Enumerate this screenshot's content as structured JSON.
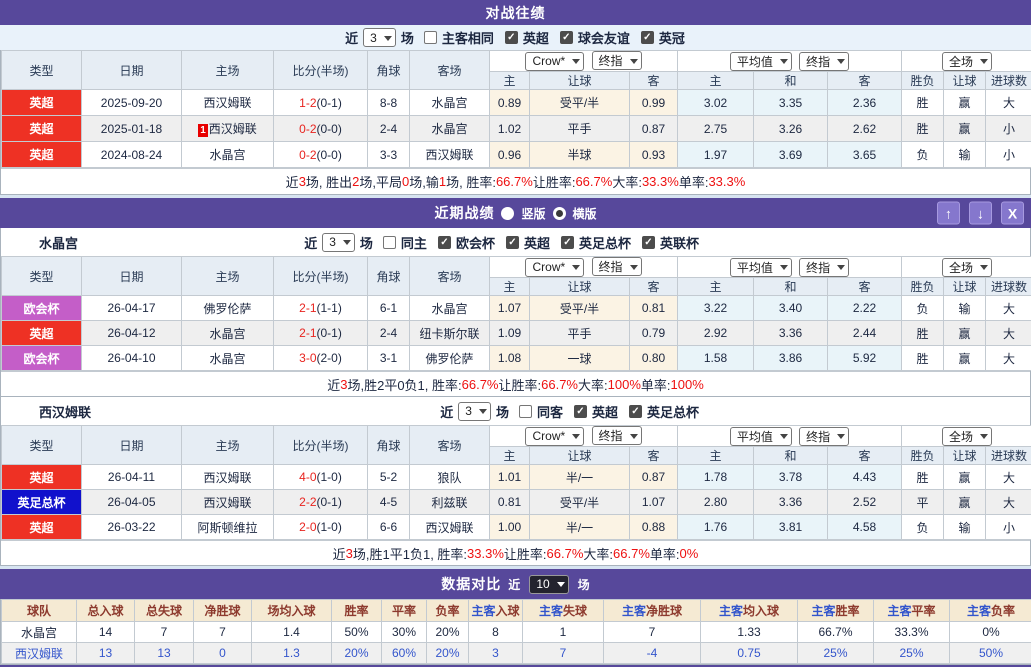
{
  "colors": {
    "purple": "#57489b",
    "type_red": "#ee3124",
    "type_orchid": "#c45ec8",
    "type_blue": "#1111cc",
    "team_green": "#0a9a3c",
    "win_red": "#e8241f",
    "lose_blue": "#1414cc",
    "draw_green": "#0a9a3c",
    "summary_red": "#ee1111",
    "compare_blue": "#3355cc",
    "compare_maroon": "#8d3a2e"
  },
  "icons": {
    "up": "↑",
    "down": "↓",
    "close": "X"
  },
  "dd": {
    "crow": "Crow*",
    "final": "终指",
    "avg": "平均值",
    "full": "全场"
  },
  "cols": {
    "type": "类型",
    "date": "日期",
    "home": "主场",
    "score": "比分(半场)",
    "corner": "角球",
    "away": "客场",
    "h": "主",
    "handicap": "让球",
    "a": "客",
    "avg_h": "主",
    "avg_d": "和",
    "avg_a": "客",
    "wl": "胜负",
    "hd": "让球",
    "goals": "进球数"
  },
  "h2h": {
    "title": "对战往绩",
    "filter": {
      "near": "近",
      "n": "3",
      "games": "场",
      "same": "主客相同",
      "leagues": [
        "英超",
        "球会友谊",
        "英冠"
      ]
    },
    "rows": [
      {
        "type": "英超",
        "badge": "",
        "date": "2025-09-20",
        "home": "西汉姆联",
        "home_c": "",
        "score": "1-2",
        "half": "(0-1)",
        "corner": "8-8",
        "away": "水晶宫",
        "away_c": "green",
        "o_h": "0.89",
        "o_hc": "受平/半",
        "o_a": "0.99",
        "m_h": "3.02",
        "m_d": "3.35",
        "m_a": "2.36",
        "wl": "胜",
        "wl_c": "red",
        "hd": "赢",
        "hd_c": "red",
        "gl": "大",
        "gl_c": "red"
      },
      {
        "type": "英超",
        "badge": "1",
        "date": "2025-01-18",
        "home": "西汉姆联",
        "home_c": "",
        "score": "0-2",
        "half": "(0-0)",
        "corner": "2-4",
        "away": "水晶宫",
        "away_c": "green",
        "o_h": "1.02",
        "o_hc": "平手",
        "o_a": "0.87",
        "m_h": "2.75",
        "m_d": "3.26",
        "m_a": "2.62",
        "wl": "胜",
        "wl_c": "red",
        "hd": "赢",
        "hd_c": "red",
        "gl": "小",
        "gl_c": "blue"
      },
      {
        "type": "英超",
        "badge": "",
        "date": "2024-08-24",
        "home": "水晶宫",
        "home_c": "green",
        "score": "0-2",
        "half": "(0-0)",
        "corner": "3-3",
        "away": "西汉姆联",
        "away_c": "",
        "o_h": "0.96",
        "o_hc": "半球",
        "o_a": "0.93",
        "m_h": "1.97",
        "m_d": "3.69",
        "m_a": "3.65",
        "wl": "负",
        "wl_c": "blue",
        "hd": "输",
        "hd_c": "blue",
        "gl": "小",
        "gl_c": "blue"
      }
    ],
    "summary": [
      {
        "t": "近 "
      },
      {
        "t": "3",
        "c": "red"
      },
      {
        "t": " 场, 胜出 "
      },
      {
        "t": "2",
        "c": "red"
      },
      {
        "t": " 场,平局 "
      },
      {
        "t": "0",
        "c": "red"
      },
      {
        "t": " 场,输 "
      },
      {
        "t": "1",
        "c": "red"
      },
      {
        "t": " 场, 胜率: "
      },
      {
        "t": "66.7%",
        "c": "red"
      },
      {
        "t": " 让胜率: "
      },
      {
        "t": "66.7%",
        "c": "red"
      },
      {
        "t": " 大率: "
      },
      {
        "t": "33.3%",
        "c": "red"
      },
      {
        "t": " 单率: "
      },
      {
        "t": "33.3%",
        "c": "red"
      }
    ]
  },
  "recent": {
    "title": "近期战绩",
    "radios": [
      "竖版",
      "横版"
    ],
    "teams": [
      {
        "name": "水晶宫",
        "filter": {
          "near": "近",
          "n": "3",
          "games": "场",
          "same": "同主",
          "leagues": [
            "欧会杯",
            "英超",
            "英足总杯",
            "英联杯"
          ]
        },
        "rows": [
          {
            "type": "欧会杯",
            "date": "26-04-17",
            "home": "佛罗伦萨",
            "home_c": "",
            "score": "2-1",
            "half": "(1-1)",
            "corner": "6-1",
            "away": "水晶宫",
            "away_c": "green",
            "o_h": "1.07",
            "o_hc": "受平/半",
            "o_a": "0.81",
            "m_h": "3.22",
            "m_d": "3.40",
            "m_a": "2.22",
            "wl": "负",
            "wl_c": "blue",
            "hd": "输",
            "hd_c": "blue",
            "gl": "大",
            "gl_c": "red"
          },
          {
            "type": "英超",
            "date": "26-04-12",
            "home": "水晶宫",
            "home_c": "green",
            "score": "2-1",
            "half": "(0-1)",
            "corner": "2-4",
            "away": "纽卡斯尔联",
            "away_c": "",
            "o_h": "1.09",
            "o_hc": "平手",
            "o_a": "0.79",
            "m_h": "2.92",
            "m_d": "3.36",
            "m_a": "2.44",
            "wl": "胜",
            "wl_c": "red",
            "hd": "赢",
            "hd_c": "red",
            "gl": "大",
            "gl_c": "red"
          },
          {
            "type": "欧会杯",
            "date": "26-04-10",
            "home": "水晶宫",
            "home_c": "green",
            "score": "3-0",
            "half": "(2-0)",
            "corner": "3-1",
            "away": "佛罗伦萨",
            "away_c": "",
            "o_h": "1.08",
            "o_hc": "一球",
            "o_a": "0.80",
            "m_h": "1.58",
            "m_d": "3.86",
            "m_a": "5.92",
            "wl": "胜",
            "wl_c": "red",
            "hd": "赢",
            "hd_c": "red",
            "gl": "大",
            "gl_c": "red"
          }
        ],
        "summary": [
          {
            "t": "近"
          },
          {
            "t": "3",
            "c": "red"
          },
          {
            "t": "场,胜2平0负1, 胜率:"
          },
          {
            "t": "66.7%",
            "c": "red"
          },
          {
            "t": " 让胜率:"
          },
          {
            "t": "66.7%",
            "c": "red"
          },
          {
            "t": " 大率:"
          },
          {
            "t": "100%",
            "c": "red"
          },
          {
            "t": " 单率:"
          },
          {
            "t": "100%",
            "c": "red"
          }
        ]
      },
      {
        "name": "西汉姆联",
        "filter": {
          "near": "近",
          "n": "3",
          "games": "场",
          "same": "同客",
          "leagues": [
            "英超",
            "英足总杯"
          ]
        },
        "rows": [
          {
            "type": "英超",
            "date": "26-04-11",
            "home": "西汉姆联",
            "home_c": "green",
            "score": "4-0",
            "half": "(1-0)",
            "corner": "5-2",
            "away": "狼队",
            "away_c": "",
            "o_h": "1.01",
            "o_hc": "半/一",
            "o_a": "0.87",
            "m_h": "1.78",
            "m_d": "3.78",
            "m_a": "4.43",
            "wl": "胜",
            "wl_c": "red",
            "hd": "赢",
            "hd_c": "red",
            "gl": "大",
            "gl_c": "red"
          },
          {
            "type": "英足总杯",
            "date": "26-04-05",
            "home": "西汉姆联",
            "home_c": "green",
            "score": "2-2",
            "half": "(0-1)",
            "corner": "4-5",
            "away": "利兹联",
            "away_c": "",
            "o_h": "0.81",
            "o_hc": "受平/半",
            "o_a": "1.07",
            "m_h": "2.80",
            "m_d": "3.36",
            "m_a": "2.52",
            "wl": "平",
            "wl_c": "green",
            "hd": "赢",
            "hd_c": "red",
            "gl": "大",
            "gl_c": "red"
          },
          {
            "type": "英超",
            "date": "26-03-22",
            "home": "阿斯顿维拉",
            "home_c": "",
            "score": "2-0",
            "half": "(1-0)",
            "corner": "6-6",
            "away": "西汉姆联",
            "away_c": "green",
            "o_h": "1.00",
            "o_hc": "半/一",
            "o_a": "0.88",
            "m_h": "1.76",
            "m_d": "3.81",
            "m_a": "4.58",
            "wl": "负",
            "wl_c": "blue",
            "hd": "输",
            "hd_c": "blue",
            "gl": "小",
            "gl_c": "blue"
          }
        ],
        "summary": [
          {
            "t": "近"
          },
          {
            "t": "3",
            "c": "red"
          },
          {
            "t": "场,胜1平1负1, 胜率:"
          },
          {
            "t": "33.3%",
            "c": "red"
          },
          {
            "t": " 让胜率:"
          },
          {
            "t": "66.7%",
            "c": "red"
          },
          {
            "t": " 大率:"
          },
          {
            "t": "66.7%",
            "c": "red"
          },
          {
            "t": " 单率:"
          },
          {
            "t": "0%",
            "c": "red"
          }
        ]
      }
    ]
  },
  "compare": {
    "title": "数据对比",
    "near": "近",
    "n": "10",
    "games": "场",
    "headers": [
      [
        {
          "t": "球队"
        }
      ],
      [
        {
          "t": "总入球"
        }
      ],
      [
        {
          "t": "总失球"
        }
      ],
      [
        {
          "t": "净胜球"
        }
      ],
      [
        {
          "t": "场均入球"
        }
      ],
      [
        {
          "t": "胜率"
        }
      ],
      [
        {
          "t": "平率"
        }
      ],
      [
        {
          "t": "负率"
        }
      ],
      [
        {
          "t": "主客",
          "c": "blue"
        },
        {
          "t": "入球"
        }
      ],
      [
        {
          "t": "主客",
          "c": "blue"
        },
        {
          "t": "失球"
        }
      ],
      [
        {
          "t": "主客",
          "c": "blue"
        },
        {
          "t": "净胜球"
        }
      ],
      [
        {
          "t": "主客",
          "c": "blue"
        },
        {
          "t": "均入球"
        }
      ],
      [
        {
          "t": "主客",
          "c": "blue"
        },
        {
          "t": "胜率"
        }
      ],
      [
        {
          "t": "主客",
          "c": "blue"
        },
        {
          "t": "平率"
        }
      ],
      [
        {
          "t": "主客",
          "c": "blue"
        },
        {
          "t": "负率"
        }
      ]
    ],
    "rows": [
      {
        "team": "水晶宫",
        "values": [
          "14",
          "7",
          "7",
          "1.4",
          "50%",
          "30%",
          "20%",
          "8",
          "1",
          "7",
          "1.33",
          "66.7%",
          "33.3%",
          "0%"
        ]
      },
      {
        "team": "西汉姆联",
        "values": [
          "13",
          "13",
          "0",
          "1.3",
          "20%",
          "60%",
          "20%",
          "3",
          "7",
          "-4",
          "0.75",
          "25%",
          "25%",
          "50%"
        ]
      }
    ]
  }
}
